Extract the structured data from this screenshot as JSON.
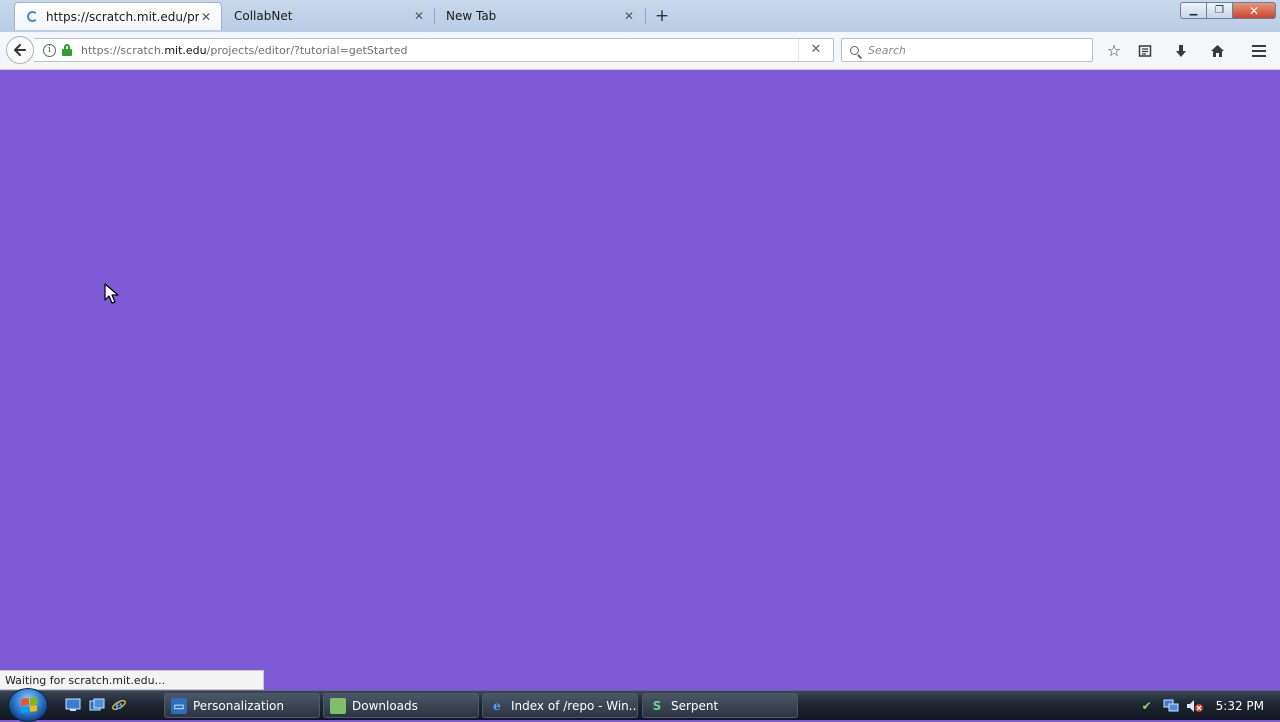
{
  "browser": {
    "tabs": [
      {
        "title": "https://scratch.mit.edu/proj",
        "active": true,
        "loading": true
      },
      {
        "title": "CollabNet",
        "active": false
      },
      {
        "title": "New Tab",
        "active": false
      }
    ],
    "new_tab_icon": "plus-icon",
    "url_prefix": "https://scratch.",
    "url_host": "mit.edu",
    "url_path": "/projects/editor/?tutorial=getStarted",
    "search_placeholder": "Search",
    "toolbar_icons": [
      "bookmark-star-icon",
      "reading-list-icon",
      "download-icon",
      "home-icon",
      "hamburger-menu-icon"
    ]
  },
  "page": {
    "background_color": "#7f5ad6"
  },
  "status_text": "Waiting for scratch.mit.edu...",
  "taskbar": {
    "buttons": [
      {
        "label": "Personalization",
        "icon": "monitor-icon"
      },
      {
        "label": "Downloads",
        "icon": "folder-icon"
      },
      {
        "label": "Index of /repo - Win...",
        "icon": "internet-explorer-icon"
      },
      {
        "label": "Serpent",
        "icon": "serpent-app-icon"
      }
    ],
    "clock": "5:32 PM"
  }
}
